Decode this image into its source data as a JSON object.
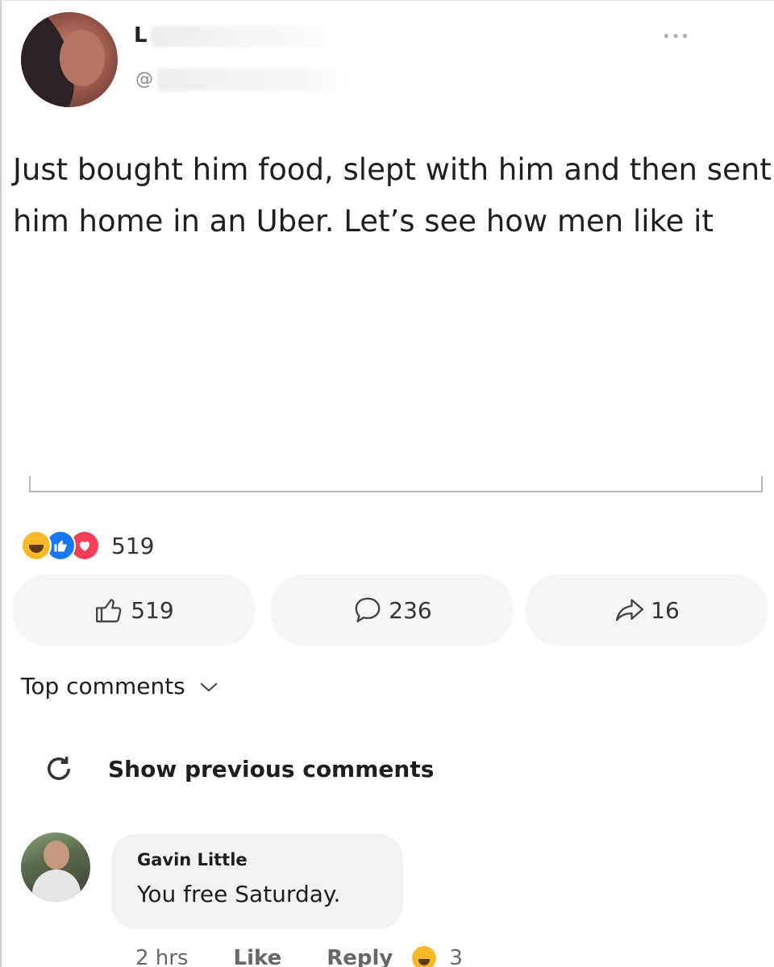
{
  "tweet": {
    "author_initial": "L",
    "handle_prefix": "@",
    "more_label": "•••",
    "text": "Just bought him food, slept with him and then sent him home in an Uber. Let’s see how men like it"
  },
  "reactions": {
    "icons": [
      "haha-icon",
      "like-icon",
      "love-icon"
    ],
    "count": "519",
    "colors": {
      "haha": "#f7b928",
      "like": "#1877f2",
      "love": "#f33e58"
    }
  },
  "actions": {
    "like_count": "519",
    "comment_count": "236",
    "share_count": "16"
  },
  "comments": {
    "sort_label": "Top comments",
    "show_previous_label": "Show previous comments",
    "items": [
      {
        "author": "Gavin Little",
        "text": "You free Saturday.",
        "time": "2 hrs",
        "like_label": "Like",
        "reply_label": "Reply",
        "reaction_count": "3"
      }
    ]
  }
}
